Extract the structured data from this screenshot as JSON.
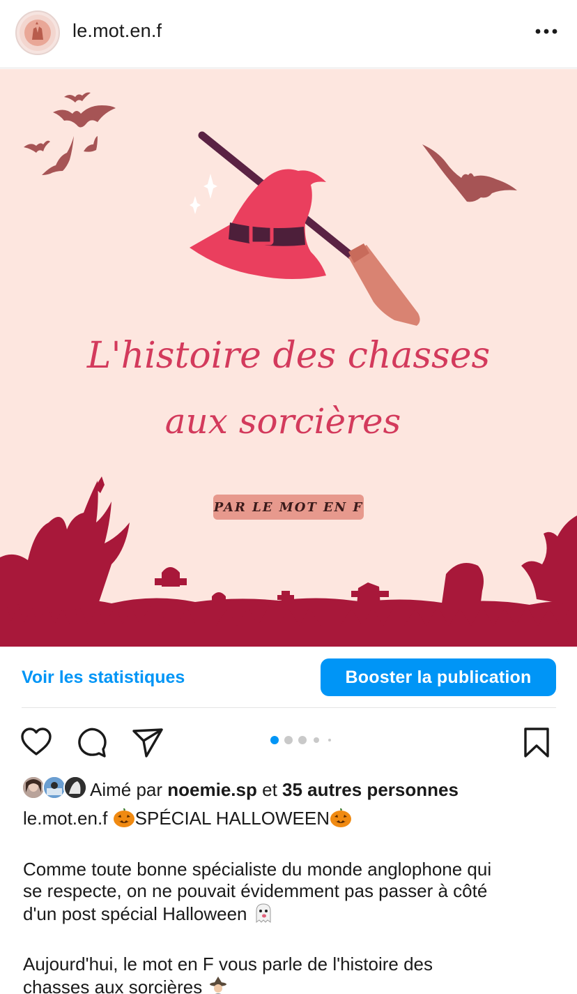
{
  "header": {
    "username": "le.mot.en.f",
    "more_icon": "more-horizontal-icon"
  },
  "post_image": {
    "title_line1": "L'histoire des chasses",
    "title_line2": "aux sorcières",
    "byline": "PAR LE MOT EN F",
    "colors": {
      "background": "#fde6df",
      "accent": "#d33a5c",
      "silhouette": "#a8183a",
      "bat": "#a65455"
    }
  },
  "stats": {
    "view_stats_label": "Voir les statistiques",
    "boost_label": "Booster la publication"
  },
  "actions": {
    "carousel_dot_count": 5,
    "carousel_active_index": 0
  },
  "likes": {
    "prefix": "Aimé par",
    "user": "noemie.sp",
    "connector": "et",
    "others": "35 autres personnes"
  },
  "caption": {
    "username": "le.mot.en.f",
    "headline": "SPÉCIAL HALLOWEEN",
    "p1_l1": "Comme toute bonne spécialiste du monde anglophone qui",
    "p1_l2": "se respecte, on ne pouvait évidemment pas passer à côté",
    "p1_l3": "d'un post spécial Halloween",
    "p2_l1": "Aujourd'hui, le mot en F vous parle de l'histoire des",
    "p2_l2": "chasses aux sorcières"
  },
  "accent_color": "#0095f6"
}
